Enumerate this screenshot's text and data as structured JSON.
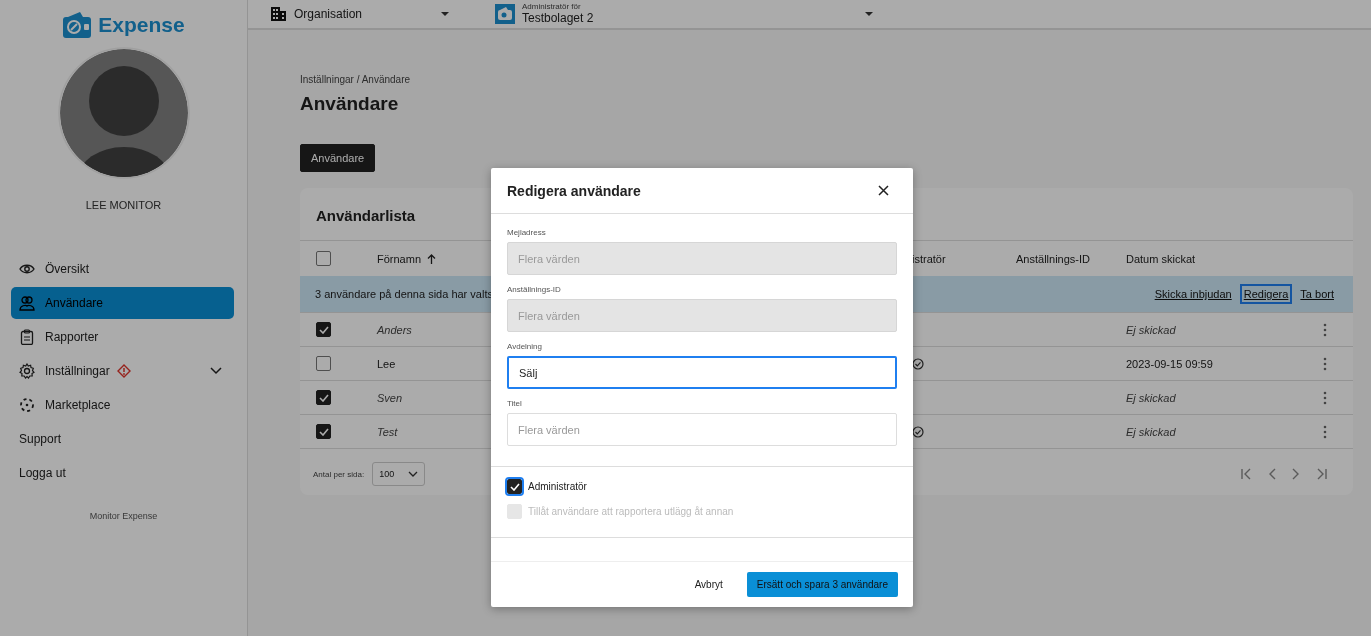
{
  "sidebar": {
    "logo": "Expense",
    "user_name": "LEE MONITOR",
    "items": [
      {
        "label": "Översikt",
        "selected": false,
        "warning": false,
        "has_submenu": false
      },
      {
        "label": "Användare",
        "selected": true,
        "warning": false,
        "has_submenu": false
      },
      {
        "label": "Rapporter",
        "selected": false,
        "warning": false,
        "has_submenu": false
      },
      {
        "label": "Inställningar",
        "selected": false,
        "warning": true,
        "has_submenu": true
      },
      {
        "label": "Marketplace",
        "selected": false,
        "warning": false,
        "has_submenu": false
      },
      {
        "label": "Support",
        "selected": false,
        "warning": false,
        "has_submenu": false
      },
      {
        "label": "Logga ut",
        "selected": false,
        "warning": false,
        "has_submenu": false
      }
    ],
    "footer": "Monitor Expense"
  },
  "topbar": {
    "organisation": "Organisation",
    "company_caption": "Administratör för",
    "company": "Testbolaget 2"
  },
  "breadcrumb": "Inställningar / Användare",
  "title": "Användare",
  "tabs": [
    {
      "label": "Användare",
      "selected": true
    }
  ],
  "table": {
    "title": "Användarlista",
    "all_selected": false,
    "columns": [
      {
        "label": "Förnamn",
        "sorted": true
      },
      {
        "label": "istratör",
        "sorted": false
      },
      {
        "label": "Anställnings-ID",
        "sorted": false
      },
      {
        "label": "Datum skickat",
        "sorted": false
      }
    ],
    "selection": {
      "text": "3 användare på denna sida har valts",
      "actions": [
        {
          "label": "Skicka inbjudan",
          "focused": false
        },
        {
          "label": "Redigera",
          "focused": true
        },
        {
          "label": "Ta bort",
          "focused": false
        }
      ]
    },
    "rows": [
      {
        "selected": true,
        "first_name": "Anders",
        "admin": false,
        "invited": false,
        "date": "Ej skickad"
      },
      {
        "selected": false,
        "first_name": "Lee",
        "admin": true,
        "invited": true,
        "date": "2023-09-15 09:59"
      },
      {
        "selected": true,
        "first_name": "Sven",
        "admin": false,
        "invited": false,
        "date": "Ej skickad"
      },
      {
        "selected": true,
        "first_name": "Test",
        "admin": true,
        "invited": false,
        "date": "Ej skickad"
      }
    ],
    "per_page_label": "Antal per sida:",
    "per_page": "100"
  },
  "dialog": {
    "title": "Redigera användare",
    "fields": [
      {
        "label": "Mejladress",
        "placeholder": "Flera värden",
        "disabled": true,
        "focused": false
      },
      {
        "label": "Anställnings-ID",
        "placeholder": "Flera värden",
        "disabled": true,
        "focused": false
      },
      {
        "label": "Avdelning",
        "value": "Sälj",
        "disabled": false,
        "focused": true
      },
      {
        "label": "Titel",
        "placeholder": "Flera värden",
        "disabled": false,
        "focused": false
      }
    ],
    "checkboxes": [
      {
        "label": "Administratör",
        "checked": true,
        "disabled": false,
        "focused": true
      },
      {
        "label": "Tillåt användare att rapportera utlägg åt annan",
        "checked": false,
        "disabled": true,
        "focused": false
      }
    ],
    "buttons": [
      {
        "label": "Avbryt",
        "kind": "text"
      },
      {
        "label": "Ersätt och spara 3 användare",
        "kind": "primary"
      }
    ]
  }
}
